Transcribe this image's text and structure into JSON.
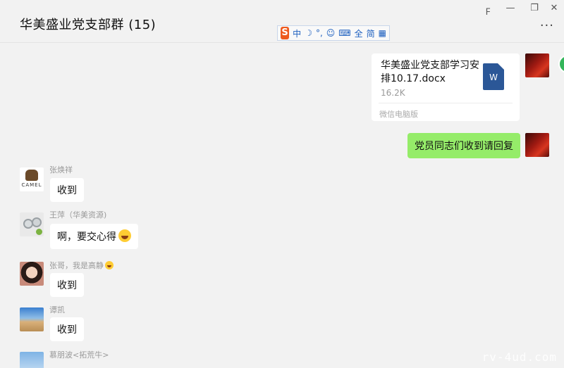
{
  "window": {
    "title": "华美盛业党支部群 (15)",
    "controls": {
      "pin": "𝈓",
      "minimize": "—",
      "maximize": "❐",
      "close": "✕"
    },
    "more": "···"
  },
  "ime_bar": {
    "logo": "S",
    "items": [
      "中",
      "☽",
      "°,",
      "☺",
      "⌨",
      "全",
      "简",
      "▦"
    ]
  },
  "messages": [
    {
      "type": "file",
      "from": "self",
      "file_name": "华美盛业党支部学习安排10.17.docx",
      "file_size": "16.2K",
      "source": "微信电脑版",
      "file_icon": "W"
    },
    {
      "type": "text",
      "from": "self",
      "text": "党员同志们收到请回复"
    },
    {
      "type": "text",
      "from": "other",
      "sender": "张焕祥",
      "avatar_text": "CAMEL",
      "text": "收到"
    },
    {
      "type": "text",
      "from": "other",
      "sender": "王萍（华美资源)",
      "text": "啊，要交心得"
    },
    {
      "type": "text",
      "from": "other",
      "sender": "张哥，我是高静",
      "text": "收到"
    },
    {
      "type": "text",
      "from": "other",
      "sender": "谭凯",
      "text": "收到"
    },
    {
      "type": "text",
      "from": "other",
      "sender": "慕朋波<拓荒牛>"
    }
  ],
  "watermark": "rv-4ud.com"
}
